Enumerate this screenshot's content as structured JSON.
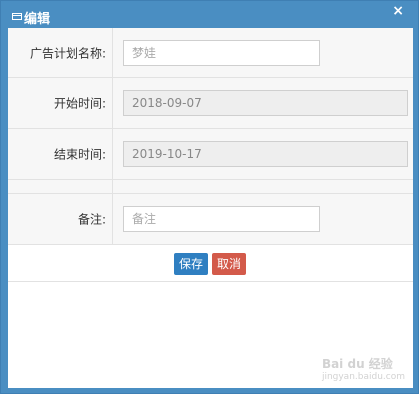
{
  "dialog": {
    "title": "编辑",
    "close_glyph": "×",
    "title_icon": "window-icon"
  },
  "form": {
    "plan_name": {
      "label": "广告计划名称:",
      "placeholder": "梦娃"
    },
    "start_time": {
      "label": "开始时间:",
      "value": "2018-09-07"
    },
    "end_time": {
      "label": "结束时间:",
      "value": "2019-10-17"
    },
    "remark": {
      "label": "备注:",
      "placeholder": "备注"
    }
  },
  "actions": {
    "save_label": "保存",
    "cancel_label": "取消"
  },
  "watermark": {
    "brand": "Bai du 经验",
    "url": "jingyan.baidu.com"
  },
  "colors": {
    "titlebar": "#4a8ec2",
    "save": "#2f7fc1",
    "cancel": "#d35a4a"
  }
}
